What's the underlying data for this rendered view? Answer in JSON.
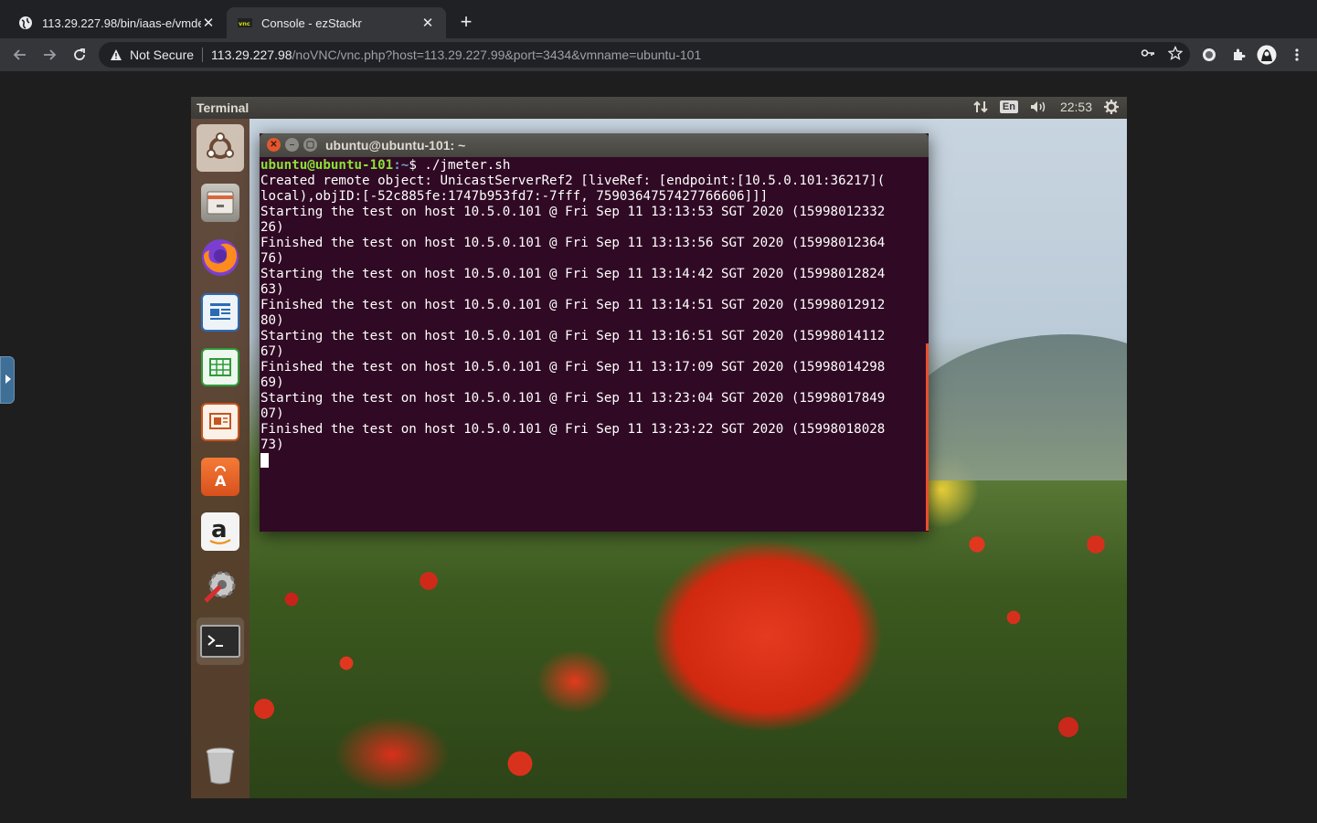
{
  "browser": {
    "tabs": [
      {
        "title": "113.29.227.98/bin/iaas-e/vmde",
        "active": false
      },
      {
        "title": "Console - ezStackr",
        "active": true
      }
    ],
    "security_label": "Not Secure",
    "url_host": "113.29.227.98",
    "url_path": "/noVNC/vnc.php?host=113.29.227.99&port=3434&vmname=ubuntu-101"
  },
  "desktop": {
    "app_title": "Terminal",
    "language": "En",
    "clock": "22:53",
    "launcher_items": [
      "dash-home",
      "files",
      "firefox",
      "libreoffice-writer",
      "libreoffice-calc",
      "libreoffice-impress",
      "ubuntu-software-center",
      "amazon",
      "system-settings",
      "terminal",
      "trash"
    ]
  },
  "terminal": {
    "window_title": "ubuntu@ubuntu-101: ~",
    "prompt_user": "ubuntu@ubuntu-101",
    "prompt_path": ":~",
    "prompt_symbol": "$ ",
    "command": "./jmeter.sh",
    "output": [
      "Created remote object: UnicastServerRef2 [liveRef: [endpoint:[10.5.0.101:36217](",
      "local),objID:[-52c885fe:1747b953fd7:-7fff, 7590364757427766606]]]",
      "Starting the test on host 10.5.0.101 @ Fri Sep 11 13:13:53 SGT 2020 (15998012332",
      "26)",
      "Finished the test on host 10.5.0.101 @ Fri Sep 11 13:13:56 SGT 2020 (15998012364",
      "76)",
      "Starting the test on host 10.5.0.101 @ Fri Sep 11 13:14:42 SGT 2020 (15998012824",
      "63)",
      "Finished the test on host 10.5.0.101 @ Fri Sep 11 13:14:51 SGT 2020 (15998012912",
      "80)",
      "Starting the test on host 10.5.0.101 @ Fri Sep 11 13:16:51 SGT 2020 (15998014112",
      "67)",
      "Finished the test on host 10.5.0.101 @ Fri Sep 11 13:17:09 SGT 2020 (15998014298",
      "69)",
      "Starting the test on host 10.5.0.101 @ Fri Sep 11 13:23:04 SGT 2020 (15998017849",
      "07)",
      "Finished the test on host 10.5.0.101 @ Fri Sep 11 13:23:22 SGT 2020 (15998018028",
      "73)"
    ]
  },
  "colors": {
    "terminal_bg": "#300a24",
    "prompt_user": "#8ae234",
    "prompt_path": "#729fcf",
    "launcher_bg": "#583e2e"
  }
}
